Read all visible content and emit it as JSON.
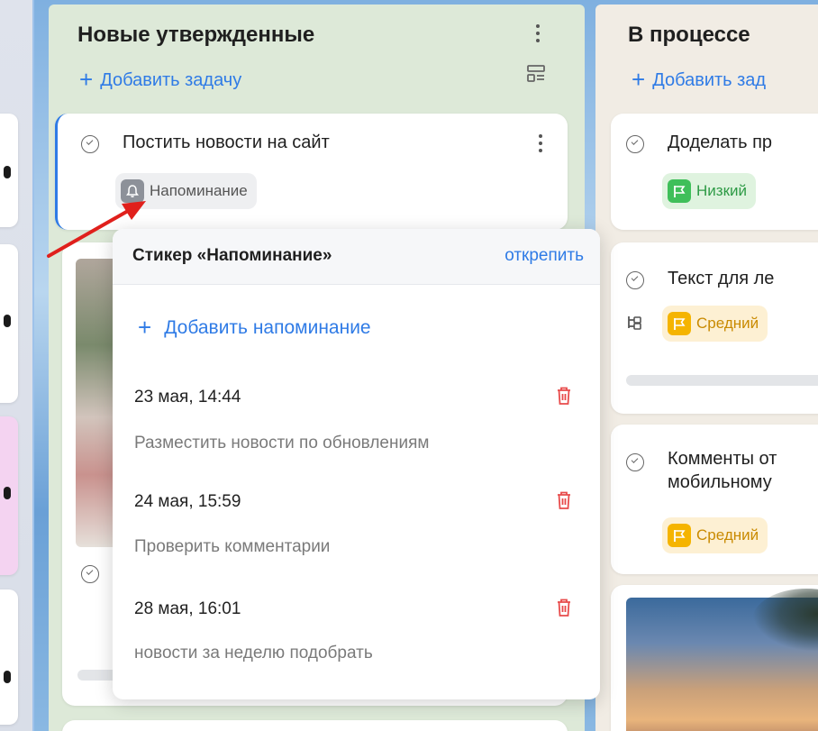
{
  "columns": [
    {
      "title": "Новые утвержденные",
      "add_label": "Добавить задачу",
      "cards": [
        {
          "title": "Постить новости на сайт",
          "sticker": "Напоминание"
        }
      ]
    },
    {
      "title": "В процессе",
      "add_label": "Добавить зад",
      "cards": [
        {
          "title": "Доделать пр",
          "priority": "Низкий"
        },
        {
          "title": "Текст для ле",
          "priority": "Средний"
        },
        {
          "title_line1": "Комменты от",
          "title_line2": "мобильному",
          "priority": "Средний"
        }
      ]
    }
  ],
  "popup": {
    "title": "Стикер «Напоминание»",
    "unpin_label": "открепить",
    "add_label": "Добавить напоминание",
    "reminders": [
      {
        "date": "23 мая, 14:44",
        "text": "Разместить новости по обновлениям"
      },
      {
        "date": "24 мая, 15:59",
        "text": "Проверить комментарии"
      },
      {
        "date": "28 мая, 16:01",
        "text": "новости за неделю подобрать"
      }
    ]
  },
  "colors": {
    "accent": "#2f7be6",
    "low_priority": "#3fbf5a",
    "medium_priority": "#f5b400",
    "delete": "#e84b4b",
    "arrow": "#e0201c"
  },
  "icons": {
    "check": "check-circle-icon",
    "bell": "bell-icon",
    "flag": "flag-icon",
    "trash": "trash-icon",
    "subtasks": "subtasks-icon",
    "template": "card-template-icon"
  }
}
